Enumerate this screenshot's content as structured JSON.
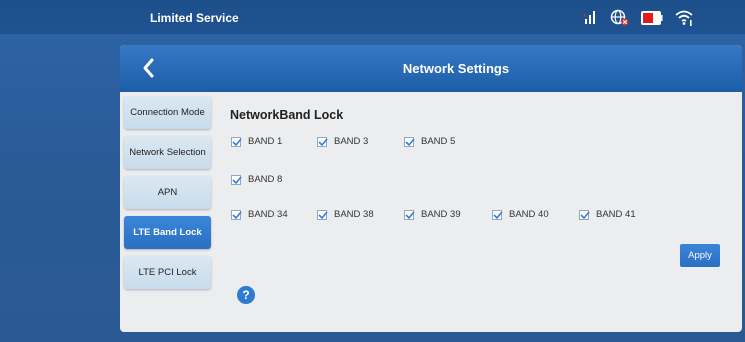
{
  "status": {
    "text": "Limited Service",
    "icons": [
      "signal-icon",
      "globe-disconnected-icon",
      "battery-low-icon",
      "wifi-icon"
    ]
  },
  "header": {
    "title": "Network Settings",
    "back_icon": "chevron-left-icon"
  },
  "sidebar": {
    "items": [
      {
        "label": "Connection Mode",
        "active": false
      },
      {
        "label": "Network Selection",
        "active": false
      },
      {
        "label": "APN",
        "active": false
      },
      {
        "label": "LTE Band Lock",
        "active": true
      },
      {
        "label": "LTE PCI Lock",
        "active": false
      }
    ]
  },
  "main": {
    "section_title": "NetworkBand Lock",
    "bands": [
      {
        "label": "BAND 1",
        "checked": true
      },
      {
        "label": "BAND 3",
        "checked": true
      },
      {
        "label": "BAND 5",
        "checked": true
      },
      {
        "label": "BAND 8",
        "checked": true
      },
      {
        "label": "BAND 34",
        "checked": true
      },
      {
        "label": "BAND 38",
        "checked": true
      },
      {
        "label": "BAND 39",
        "checked": true
      },
      {
        "label": "BAND 40",
        "checked": true
      },
      {
        "label": "BAND 41",
        "checked": true
      }
    ],
    "apply_label": "Apply",
    "help_icon": "question-icon"
  },
  "colors": {
    "background": "#25548f",
    "accent": "#2a6fc4",
    "battery": "#e21b1b"
  }
}
